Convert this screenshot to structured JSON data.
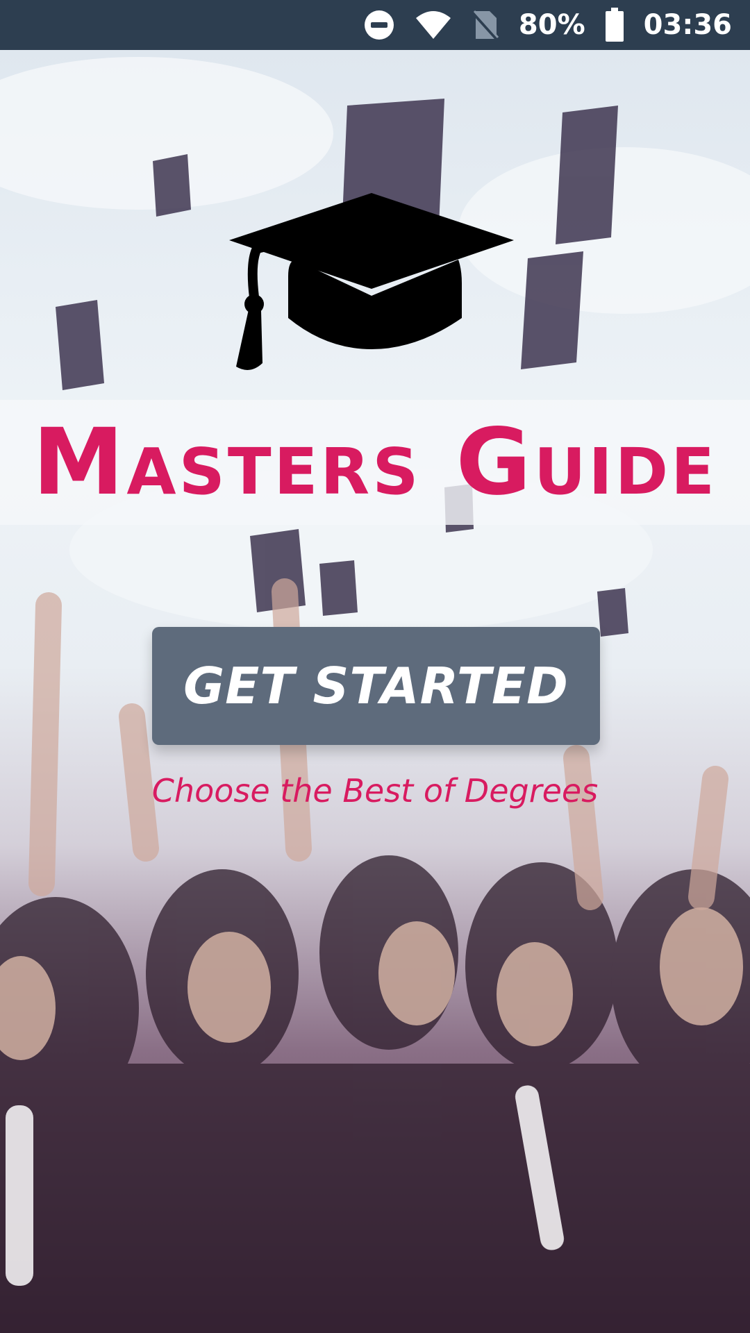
{
  "status_bar": {
    "battery_percent": "80%",
    "time": "03:36",
    "icons": [
      "do-not-disturb-icon",
      "wifi-icon",
      "no-sim-icon",
      "battery-icon"
    ]
  },
  "app": {
    "title": "Masters Guide",
    "button_label": "GET STARTED",
    "tagline": "Choose the Best of Degrees",
    "hero_icon": "graduation-cap-icon"
  },
  "colors": {
    "accent": "#d81b60",
    "status_bar": "#2d3e50",
    "button": "#5e6b7c"
  }
}
